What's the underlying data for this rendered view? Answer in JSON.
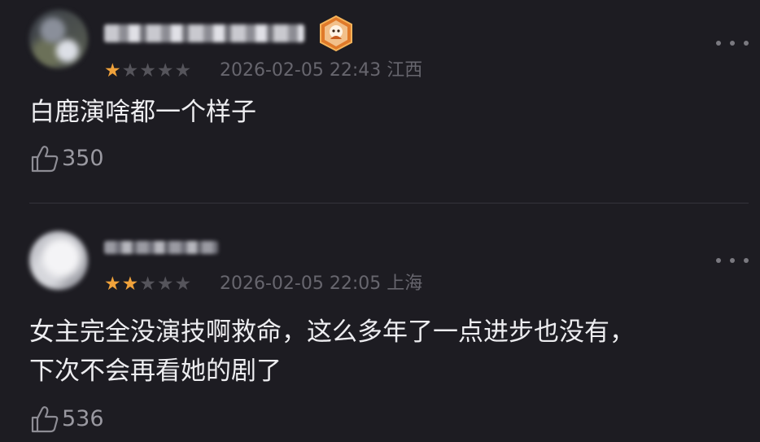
{
  "comments": [
    {
      "rating": 1,
      "date": "2026-02-05 22:43",
      "location": "江西",
      "text_lines": [
        "白鹿演啥都一个样子"
      ],
      "likes": "350",
      "has_badge": true
    },
    {
      "rating": 2,
      "date": "2026-02-05 22:05",
      "location": "上海",
      "text_lines": [
        "女主完全没演技啊救命，这么多年了一点进步也没有，",
        "下次不会再看她的剧了"
      ],
      "likes": "536",
      "has_badge": false
    }
  ],
  "icons": {
    "like": "thumbs-up-icon",
    "more": "more-dots-icon",
    "star": "star-icon",
    "badge": "level-badge-icon"
  },
  "colors": {
    "background": "#1d1c22",
    "star_on": "#f0a23b",
    "star_off": "#55545b",
    "text": "#ededf0",
    "meta": "#67666e"
  },
  "max_rating": 5
}
